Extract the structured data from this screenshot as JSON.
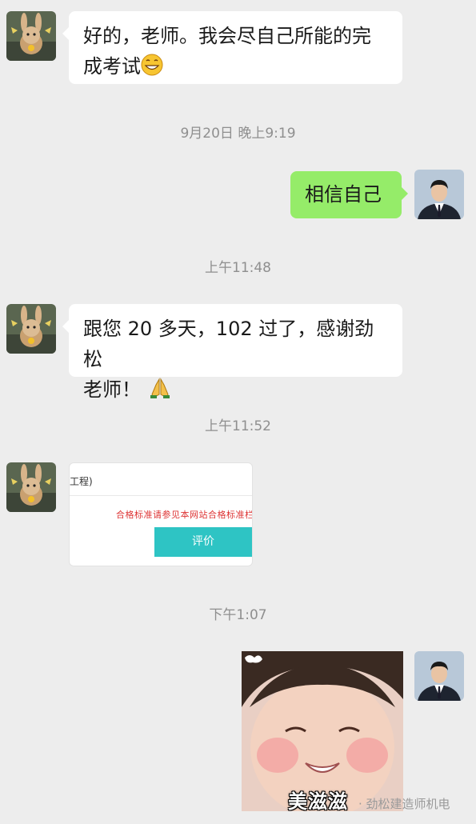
{
  "messages": {
    "m1": {
      "line1": "好的，老师。我会尽自己所能的完",
      "line2": "成考试",
      "emoji": "grinning-face"
    },
    "ts1": "9月20日 晚上9:19",
    "m2": {
      "text": "相信自己"
    },
    "ts2": "上午11:48",
    "m3": {
      "line1": "跟您 20 多天，102 过了，感谢劲松",
      "line2": "老师！",
      "emoji": "folded-hands"
    },
    "ts3": "上午11:52",
    "card": {
      "header": "工程)",
      "notice": "合格标准请参见本网站合格标准栏目",
      "button": "评价"
    },
    "ts4": "下午1:07",
    "sticker": {
      "caption": "美滋滋"
    }
  },
  "watermark": "· 劲松建造师机电",
  "colors": {
    "background": "#ededed",
    "incoming_bubble": "#ffffff",
    "outgoing_bubble": "#95ec69",
    "timestamp": "#8f8f8f",
    "card_button": "#2ec4c4",
    "card_notice": "#dd3333"
  }
}
